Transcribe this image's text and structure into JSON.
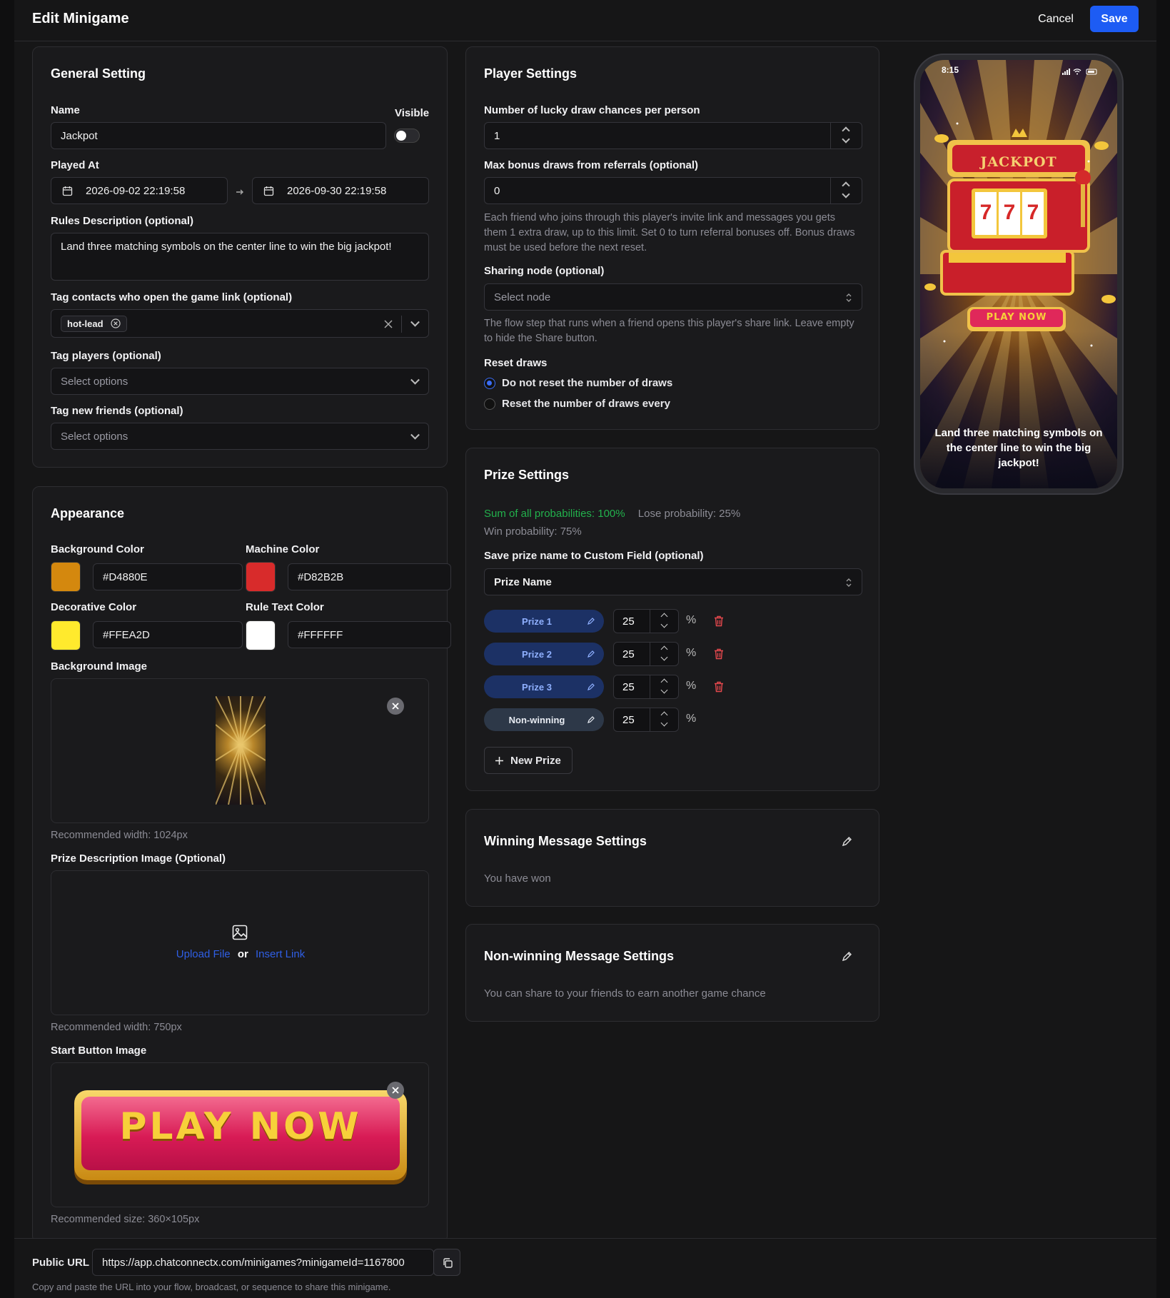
{
  "header": {
    "title": "Edit Minigame",
    "cancel": "Cancel",
    "save": "Save"
  },
  "general": {
    "title": "General Setting",
    "name_label": "Name",
    "name_value": "Jackpot",
    "visible_label": "Visible",
    "played_at_label": "Played At",
    "start_date": "2026-09-02 22:19:58",
    "end_date": "2026-09-30 22:19:58",
    "rules_label": "Rules Description (optional)",
    "rules_value": "Land three matching symbols on the center line to win the big jackpot!",
    "tag_contacts_label": "Tag contacts who open the game link (optional)",
    "tag_contacts_chip": "hot-lead",
    "tag_players_label": "Tag players (optional)",
    "tag_players_placeholder": "Select options",
    "tag_friends_label": "Tag new friends (optional)",
    "tag_friends_placeholder": "Select options"
  },
  "appearance": {
    "title": "Appearance",
    "bg_color_label": "Background Color",
    "bg_color": "#D4880E",
    "machine_color_label": "Machine Color",
    "machine_color": "#D82B2B",
    "decorative_color_label": "Decorative Color",
    "decorative_color": "#FFEA2D",
    "rule_text_color_label": "Rule Text Color",
    "rule_text_color": "#FFFFFF",
    "bg_image_label": "Background Image",
    "bg_image_note": "Recommended width: 1024px",
    "prize_image_label": "Prize Description Image (Optional)",
    "upload_file": "Upload File",
    "or": "or",
    "insert_link": "Insert Link",
    "prize_image_note": "Recommended width: 750px",
    "start_button_label": "Start Button Image",
    "start_button_text": "PLAY NOW",
    "start_button_note": "Recommended size: 360×105px"
  },
  "player": {
    "title": "Player Settings",
    "chances_label": "Number of lucky draw chances per person",
    "chances_value": "1",
    "bonus_label": "Max bonus draws from referrals (optional)",
    "bonus_value": "0",
    "bonus_help": "Each friend who joins through this player's invite link and messages you gets them 1 extra draw, up to this limit. Set 0 to turn referral bonuses off. Bonus draws must be used before the next reset.",
    "sharing_label": "Sharing node (optional)",
    "sharing_placeholder": "Select node",
    "sharing_help": "The flow step that runs when a friend opens this player's share link. Leave empty to hide the Share button.",
    "reset_label": "Reset draws",
    "reset_opt1": "Do not reset the number of draws",
    "reset_opt2": "Reset the number of draws every"
  },
  "prizes": {
    "title": "Prize Settings",
    "sum_text": "Sum of all probabilities: 100%",
    "lose_text": "Lose probability: 25%",
    "win_text": "Win probability: 75%",
    "custom_field_label": "Save prize name to Custom Field (optional)",
    "custom_field_value": "Prize Name",
    "items": [
      {
        "name": "Prize 1",
        "value": "25",
        "unit": "%"
      },
      {
        "name": "Prize 2",
        "value": "25",
        "unit": "%"
      },
      {
        "name": "Prize 3",
        "value": "25",
        "unit": "%"
      },
      {
        "name": "Non-winning",
        "value": "25",
        "unit": "%"
      }
    ],
    "new_prize": "New Prize"
  },
  "winning": {
    "title": "Winning Message Settings",
    "text": "You have won"
  },
  "nonwinning": {
    "title": "Non-winning Message Settings",
    "text": "You can share to your friends to earn another game chance"
  },
  "preview": {
    "time": "8:15",
    "sign": "JACKPOT",
    "reels": [
      "7",
      "7",
      "7"
    ],
    "play": "PLAY NOW",
    "rules": "Land three matching symbols on the center line to win the big jackpot!"
  },
  "footer": {
    "label": "Public URL",
    "url": "https://app.chatconnectx.com/minigames?minigameId=1167800",
    "help": "Copy and paste the URL into your flow, broadcast, or sequence to share this minigame."
  },
  "colors": {
    "accent": "#1d5cf4",
    "success": "#22c55e",
    "danger": "#e5484d"
  }
}
